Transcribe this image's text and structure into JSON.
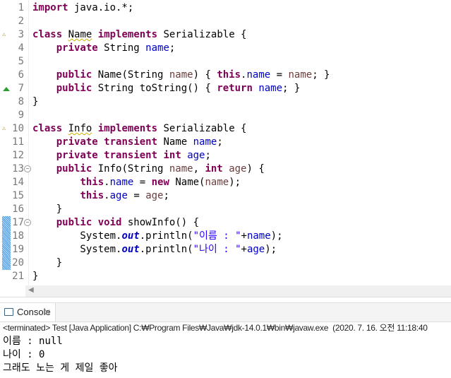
{
  "editor": {
    "lines": [
      [
        [
          "import",
          "k"
        ],
        [
          " java.io.*;",
          ""
        ]
      ],
      [],
      [
        [
          "class",
          "k"
        ],
        [
          " ",
          ""
        ],
        [
          "Name",
          "u"
        ],
        [
          " ",
          ""
        ],
        [
          "implements",
          "k"
        ],
        [
          " Serializable {",
          ""
        ]
      ],
      [
        [
          "    ",
          ""
        ],
        [
          "private",
          "k"
        ],
        [
          " String ",
          ""
        ],
        [
          "name",
          "f"
        ],
        [
          ";",
          ""
        ]
      ],
      [],
      [
        [
          "    ",
          ""
        ],
        [
          "public",
          "k"
        ],
        [
          " Name(String ",
          ""
        ],
        [
          "name",
          "pa"
        ],
        [
          ") { ",
          ""
        ],
        [
          "this",
          "k"
        ],
        [
          ".",
          ""
        ],
        [
          "name",
          "f"
        ],
        [
          " = ",
          ""
        ],
        [
          "name",
          "pa"
        ],
        [
          "; }",
          ""
        ]
      ],
      [
        [
          "    ",
          ""
        ],
        [
          "public",
          "k"
        ],
        [
          " String toString() { ",
          ""
        ],
        [
          "return",
          "k"
        ],
        [
          " ",
          ""
        ],
        [
          "name",
          "f"
        ],
        [
          "; }",
          ""
        ]
      ],
      [
        [
          "}",
          ""
        ]
      ],
      [],
      [
        [
          "class",
          "k"
        ],
        [
          " ",
          ""
        ],
        [
          "Info",
          "u"
        ],
        [
          " ",
          ""
        ],
        [
          "implements",
          "k"
        ],
        [
          " Serializable {",
          ""
        ]
      ],
      [
        [
          "    ",
          ""
        ],
        [
          "private",
          "k"
        ],
        [
          " ",
          ""
        ],
        [
          "transient",
          "k"
        ],
        [
          " Name ",
          ""
        ],
        [
          "name",
          "f"
        ],
        [
          ";",
          ""
        ]
      ],
      [
        [
          "    ",
          ""
        ],
        [
          "private",
          "k"
        ],
        [
          " ",
          ""
        ],
        [
          "transient",
          "k"
        ],
        [
          " ",
          ""
        ],
        [
          "int",
          "k"
        ],
        [
          " ",
          ""
        ],
        [
          "age",
          "f"
        ],
        [
          ";",
          ""
        ]
      ],
      [
        [
          "    ",
          ""
        ],
        [
          "public",
          "k"
        ],
        [
          " Info(String ",
          ""
        ],
        [
          "name",
          "pa"
        ],
        [
          ", ",
          ""
        ],
        [
          "int",
          "k"
        ],
        [
          " ",
          ""
        ],
        [
          "age",
          "pa"
        ],
        [
          ") {",
          ""
        ]
      ],
      [
        [
          "        ",
          ""
        ],
        [
          "this",
          "k"
        ],
        [
          ".",
          ""
        ],
        [
          "name",
          "f"
        ],
        [
          " = ",
          ""
        ],
        [
          "new",
          "k"
        ],
        [
          " Name(",
          ""
        ],
        [
          "name",
          "pa"
        ],
        [
          ");",
          ""
        ]
      ],
      [
        [
          "        ",
          ""
        ],
        [
          "this",
          "k"
        ],
        [
          ".",
          ""
        ],
        [
          "age",
          "f"
        ],
        [
          " = ",
          ""
        ],
        [
          "age",
          "pa"
        ],
        [
          ";",
          ""
        ]
      ],
      [
        [
          "    }",
          ""
        ]
      ],
      [
        [
          "    ",
          ""
        ],
        [
          "public",
          "k"
        ],
        [
          " ",
          ""
        ],
        [
          "void",
          "k"
        ],
        [
          " showInfo() {",
          ""
        ]
      ],
      [
        [
          "        System.",
          ""
        ],
        [
          "out",
          "o"
        ],
        [
          ".println(",
          ""
        ],
        [
          "\"이름 : \"",
          "s"
        ],
        [
          "+",
          ""
        ],
        [
          "name",
          "f"
        ],
        [
          ");",
          ""
        ]
      ],
      [
        [
          "        System.",
          ""
        ],
        [
          "out",
          "o"
        ],
        [
          ".println(",
          ""
        ],
        [
          "\"나이 : \"",
          "s"
        ],
        [
          "+",
          ""
        ],
        [
          "age",
          "f"
        ],
        [
          ");",
          ""
        ]
      ],
      [
        [
          "    }",
          ""
        ]
      ],
      [
        [
          "}",
          ""
        ]
      ]
    ],
    "warning_lines": [
      3,
      10
    ],
    "override_lines": [
      7
    ],
    "fold_lines": [
      13,
      17
    ],
    "changed_lines": [
      17,
      18,
      19,
      20
    ]
  },
  "console": {
    "tab_label": "Console",
    "status": "<terminated> Test [Java Application] C:₩Program Files₩Java₩jdk-14.0.1₩bin₩javaw.exe  (2020. 7. 16. 오전 11:18:40",
    "output": [
      "이름 : null",
      "나이 : 0",
      "그래도 노는 게 제일 좋아"
    ]
  }
}
